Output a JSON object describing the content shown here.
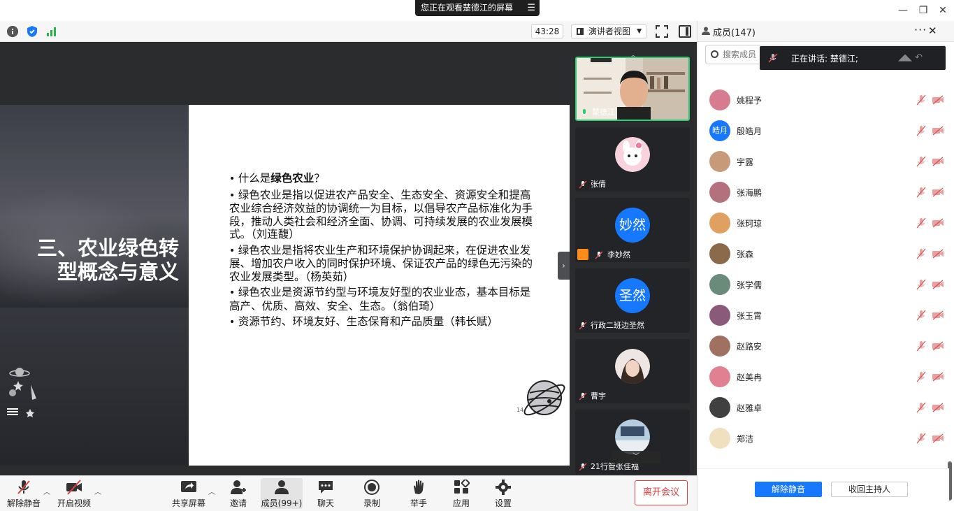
{
  "window": {
    "share_banner": "您正在观看楚德江的屏幕",
    "minimize": "—",
    "restore": "❐",
    "close": "✕"
  },
  "topbar": {
    "timer": "43:28",
    "view_mode": "演讲者视图"
  },
  "slide": {
    "title_line1": "三、农业绿色转",
    "title_line2": "型概念与意义",
    "bullets": [
      {
        "prefix": "什么是",
        "bold": "绿色农业",
        "suffix": "？"
      },
      {
        "text": "绿色农业是指以促进农产品安全、生态安全、资源安全和提高农业综合经济效益的协调统一为目标，以倡导农产品标准化为手段，推动人类社会和经济全面、协调、可持续发展的农业发展模式。（刘连馥）"
      },
      {
        "text": "绿色农业是指将农业生产和环境保护协调起来，在促进农业发展、增加农户收入的同时保护环境、保证农产品的绿色无污染的农业发展类型。（杨英茹）"
      },
      {
        "text": "绿色农业是资源节约型与环境友好型的农业业态，基本目标是高产、优质、高效、安全、生态。（翁伯琦）"
      },
      {
        "text": "资源节约、环境友好、生态保育和产品质量（韩长赋）"
      }
    ],
    "page_number": "14"
  },
  "video_tiles": [
    {
      "name": "楚德江",
      "type": "video",
      "active": true
    },
    {
      "name": "张倩",
      "type": "image",
      "color": "#f4b8c8"
    },
    {
      "name": "李妙然",
      "type": "text",
      "avatar_text": "妙然",
      "badge": true
    },
    {
      "name": "行政二班边圣然",
      "type": "text",
      "avatar_text": "圣然"
    },
    {
      "name": "曹宇",
      "type": "image",
      "color": "#e8d8d0"
    },
    {
      "name": "21行管张佳福",
      "type": "image",
      "color": "#9fb6d0"
    }
  ],
  "bottombar": {
    "mute": "解除静音",
    "video": "开启视频",
    "share": "共享屏幕",
    "invite": "邀请",
    "members": "成员(99+)",
    "chat": "聊天",
    "record": "录制",
    "raise_hand": "举手",
    "apps": "应用",
    "settings": "设置",
    "leave": "离开会议"
  },
  "members_panel": {
    "title": "成员(147)",
    "more": "···",
    "close": "✕",
    "search_placeholder": "搜索成员",
    "speaking": "正在讲话: 楚德江;",
    "members": [
      {
        "name": "姚程予",
        "color": "#d77c8e"
      },
      {
        "name": "殷皓月",
        "avatar_text": "皓月"
      },
      {
        "name": "宇露",
        "color": "#c79a7a"
      },
      {
        "name": "张海鹏",
        "color": "#b4707c"
      },
      {
        "name": "张珂琼",
        "color": "#e0a060"
      },
      {
        "name": "张森",
        "color": "#8a6a4a"
      },
      {
        "name": "张学儒",
        "color": "#6a8a7a"
      },
      {
        "name": "张玉霄",
        "color": "#8a5a7a"
      },
      {
        "name": "赵路安",
        "color": "#a07060"
      },
      {
        "name": "赵美冉",
        "color": "#e08090"
      },
      {
        "name": "赵雅卓",
        "color": "#404040"
      },
      {
        "name": "郑洁",
        "color": "#f0e0c0"
      }
    ],
    "unmute_all": "解除静音",
    "reclaim_host": "收回主持人"
  },
  "colors": {
    "accent": "#1677ff",
    "leave": "#e04040",
    "active_speaker": "#2ecc71",
    "muted": "#e05050"
  }
}
